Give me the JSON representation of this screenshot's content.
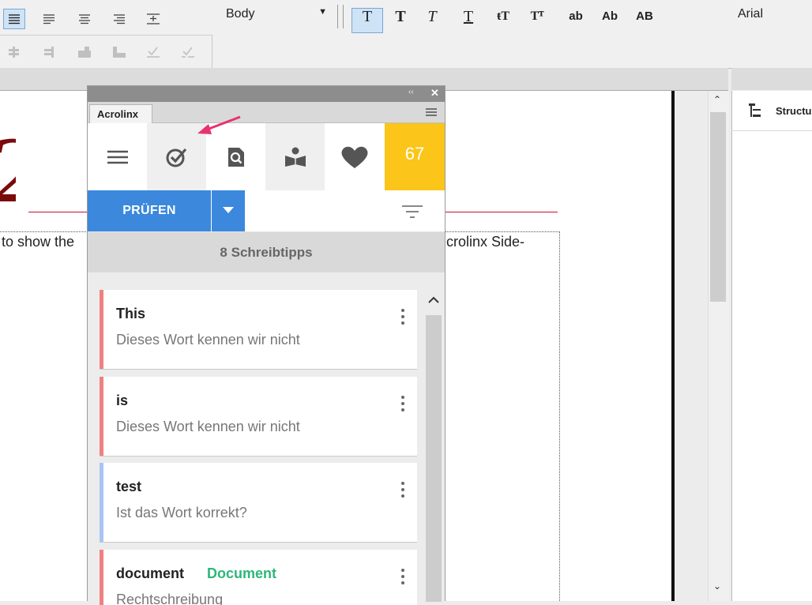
{
  "toolbar": {
    "paragraph_style": "Body",
    "font_name": "Arial",
    "char_formats": [
      "T",
      "T",
      "T",
      "T",
      "ŧT",
      "Tᵀ",
      "ab",
      "Ab",
      "AB"
    ]
  },
  "document": {
    "text_left": "to show the",
    "text_right": "crolinx Side-"
  },
  "right_panel": {
    "title": "Structu"
  },
  "acrolinx": {
    "tab_label": "Acrolinx",
    "score": "67",
    "check_button": "PRÜFEN",
    "summary": "8 Schreibtipps",
    "cards": [
      {
        "title": "This",
        "subtitle": "Dieses Wort kennen wir nicht",
        "color": "#f08080"
      },
      {
        "title": "is",
        "subtitle": "Dieses Wort kennen wir nicht",
        "color": "#f08080"
      },
      {
        "title": "test",
        "subtitle": "Ist das Wort korrekt?",
        "color": "#a9c4f5"
      },
      {
        "title": "document",
        "suggestion": "Document",
        "subtitle": "Rechtschreibung",
        "color": "#f08080"
      }
    ],
    "icons": [
      "menu-icon",
      "checkmark-icon",
      "document-search-icon",
      "reading-icon",
      "heart-icon"
    ]
  },
  "colors": {
    "score_bg": "#fbc519",
    "check_button": "#3b88dd",
    "heading_rule": "#c8102e",
    "suggestion": "#2db77b"
  }
}
